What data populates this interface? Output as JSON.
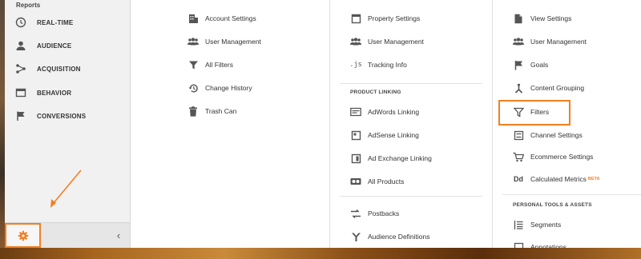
{
  "sidebar": {
    "section_label": "Reports",
    "items": [
      {
        "label": "REAL-TIME",
        "icon": "clock-icon"
      },
      {
        "label": "AUDIENCE",
        "icon": "person-icon"
      },
      {
        "label": "ACQUISITION",
        "icon": "acquisition-icon"
      },
      {
        "label": "BEHAVIOR",
        "icon": "behavior-icon"
      },
      {
        "label": "CONVERSIONS",
        "icon": "flag-icon"
      }
    ],
    "admin_icon": "gear-icon",
    "collapse_glyph": "‹"
  },
  "account": {
    "items": [
      {
        "label": "Account Settings",
        "icon": "building-icon"
      },
      {
        "label": "User Management",
        "icon": "users-icon"
      },
      {
        "label": "All Filters",
        "icon": "filter-icon"
      },
      {
        "label": "Change History",
        "icon": "history-icon"
      },
      {
        "label": "Trash Can",
        "icon": "trash-icon"
      }
    ]
  },
  "property": {
    "items": [
      {
        "label": "Property Settings",
        "icon": "property-icon"
      },
      {
        "label": "User Management",
        "icon": "users-icon"
      },
      {
        "label": "Tracking Info",
        "icon": "js-icon",
        "glyph": ".js"
      }
    ],
    "product_linking_heading": "PRODUCT LINKING",
    "linking_items": [
      {
        "label": "AdWords Linking",
        "icon": "adwords-icon"
      },
      {
        "label": "AdSense Linking",
        "icon": "adsense-icon"
      },
      {
        "label": "Ad Exchange Linking",
        "icon": "adexchange-icon"
      },
      {
        "label": "All Products",
        "icon": "all-products-icon"
      }
    ],
    "other_items": [
      {
        "label": "Postbacks",
        "icon": "postbacks-icon"
      },
      {
        "label": "Audience Definitions",
        "icon": "audience-definitions-icon"
      }
    ]
  },
  "view": {
    "items": [
      {
        "label": "View Settings",
        "icon": "document-icon"
      },
      {
        "label": "User Management",
        "icon": "users-icon"
      },
      {
        "label": "Goals",
        "icon": "flag-icon"
      },
      {
        "label": "Content Grouping",
        "icon": "content-grouping-icon"
      },
      {
        "label": "Filters",
        "icon": "filter-icon"
      },
      {
        "label": "Channel Settings",
        "icon": "channel-icon"
      },
      {
        "label": "Ecommerce Settings",
        "icon": "cart-icon"
      },
      {
        "label": "Calculated Metrics",
        "icon": "dd-icon",
        "glyph": "Dd",
        "badge": "BETA"
      }
    ],
    "personal_heading": "PERSONAL TOOLS & ASSETS",
    "personal_items": [
      {
        "label": "Segments",
        "icon": "segments-icon"
      },
      {
        "label": "Annotations",
        "icon": "annotations-icon"
      }
    ]
  },
  "colors": {
    "highlight": "#f47f20",
    "icon": "#555555",
    "text": "#333333"
  }
}
